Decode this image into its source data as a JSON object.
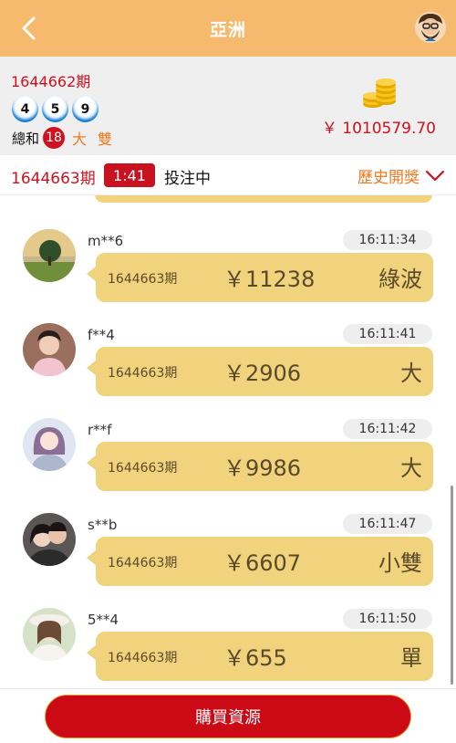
{
  "header": {
    "title": "亞洲"
  },
  "draw": {
    "period": "1644662期",
    "balls": [
      "4",
      "5",
      "9"
    ],
    "sum_label": "總和",
    "sum_value": "18",
    "tag_size": "大",
    "tag_parity": "雙",
    "balance": "￥ 1010579.70"
  },
  "status": {
    "next_period": "1644663期",
    "countdown": "1:41",
    "state": "投注中",
    "history_label": "歷史開獎"
  },
  "bets": [
    {
      "user": "m**6",
      "time": "16:11:34",
      "period": "1644663期",
      "amount": "￥11238",
      "bet": "綠波"
    },
    {
      "user": "f**4",
      "time": "16:11:41",
      "period": "1644663期",
      "amount": "￥2906",
      "bet": "大"
    },
    {
      "user": "r**f",
      "time": "16:11:42",
      "period": "1644663期",
      "amount": "￥9986",
      "bet": "大"
    },
    {
      "user": "s**b",
      "time": "16:11:47",
      "period": "1644663期",
      "amount": "￥6607",
      "bet": "小雙"
    },
    {
      "user": "5**4",
      "time": "16:11:50",
      "period": "1644663期",
      "amount": "￥655",
      "bet": "單"
    }
  ],
  "footer": {
    "buy_label": "購買資源"
  },
  "colors": {
    "header": "#f5ba6e",
    "accent_red": "#d1101f",
    "orange": "#ee7a22",
    "bubble": "#f0d37c"
  }
}
